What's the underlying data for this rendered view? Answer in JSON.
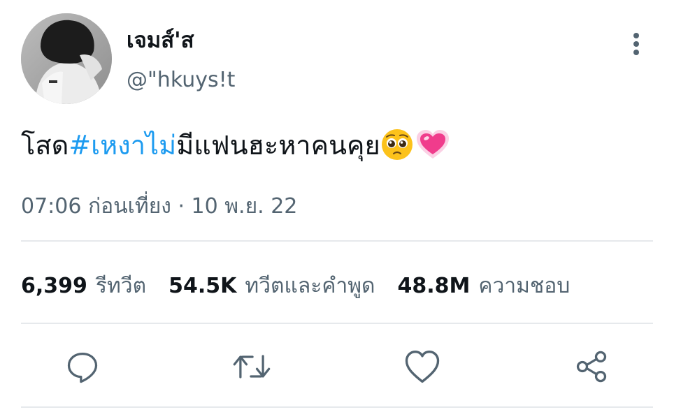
{
  "author": {
    "display_name": "เจมส์'ส",
    "handle": "@\"hkuys!t"
  },
  "tweet": {
    "text_before": "โสด",
    "hashtag": "#เหงาไม่",
    "text_after": "มีแฟนฮะหาคนคุย",
    "emojis": [
      "pleading-face-emoji",
      "sparkling-heart-emoji"
    ],
    "timestamp": "07:06 ก่อนเที่ยง · 10 พ.ย. 22"
  },
  "stats": {
    "retweets_value": "6,399",
    "retweets_label": "รีทวีต",
    "quotes_value": "54.5K",
    "quotes_label": "ทวีตและคำพูด",
    "likes_value": "48.8M",
    "likes_label": "ความชอบ"
  },
  "actions": {
    "icons": [
      "reply-icon",
      "retweet-icon",
      "like-icon",
      "share-icon"
    ]
  },
  "colors": {
    "accent": "#1d9bf0",
    "secondary_text": "#536471",
    "divider": "#e6e9ec"
  }
}
